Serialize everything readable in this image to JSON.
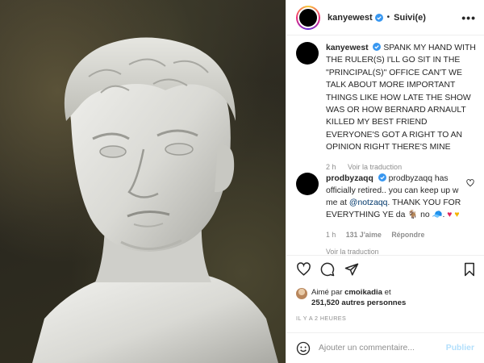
{
  "photo": {
    "alt_subject": "marble-bust"
  },
  "header": {
    "username": "kanyewest",
    "separator": "•",
    "follow_status": "Suivi(e)",
    "more_glyph": "•••"
  },
  "caption": {
    "username": "kanyewest",
    "text": "SPANK MY HAND WITH THE RULER(S) I'LL GO SIT IN THE \"PRINCIPAL(S)\" OFFICE CAN'T WE TALK ABOUT MORE IMPORTANT THINGS LIKE HOW LATE THE SHOW WAS OR HOW BERNARD ARNAULT KILLED MY BEST FRIEND EVERYONE'S GOT A RIGHT TO AN OPINION RIGHT THERE'S MINE",
    "time": "2 h",
    "translate": "Voir la traduction"
  },
  "comment": {
    "username": "prodbyzaqq",
    "text_part1": "prodbyzaqq has officially retired.. you can keep up w me at",
    "mention": "@notzaqq",
    "text_part2": ". THANK YOU FOR EVERYTHING YE da",
    "text_part3": "no",
    "time": "1 h",
    "likes": "131 J'aime",
    "reply": "Répondre",
    "translate": "Voir la traduction"
  },
  "likes": {
    "prefix": "Aimé par",
    "user": "cmoikadia",
    "conj": "et",
    "count": "251,520",
    "suffix": "autres personnes"
  },
  "timestamp": "IL Y A 2 HEURES",
  "add_comment": {
    "placeholder": "Ajouter un commentaire...",
    "publish": "Publier"
  },
  "colors": {
    "verified": "#3897f0",
    "link": "#00376b",
    "publish_disabled": "#b2dffc",
    "secondary_text": "#8e8e8e"
  }
}
